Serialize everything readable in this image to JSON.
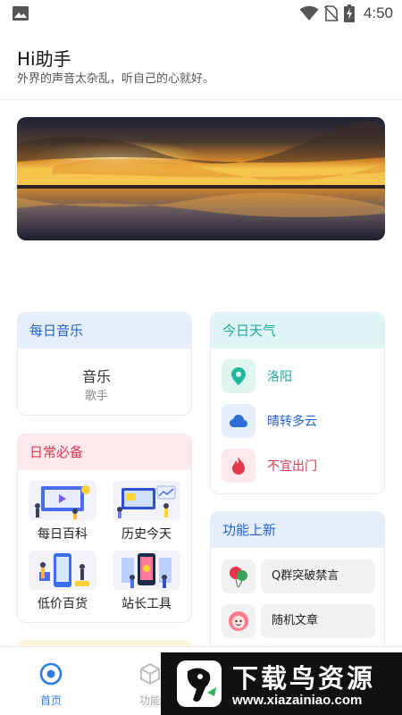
{
  "status_bar": {
    "time": "4:50",
    "icons": [
      "image-icon",
      "wifi-icon",
      "no-sim-icon",
      "battery-charging-icon"
    ]
  },
  "header": {
    "title": "Hi助手",
    "subtitle": "外界的声音太杂乱，听自己的心就好。"
  },
  "banner": {
    "image": "sunset-lake-image"
  },
  "music_card": {
    "title": "每日音乐",
    "song": "音乐",
    "artist": "歌手"
  },
  "weather_card": {
    "title": "今日天气",
    "city": "洛阳",
    "condition": "晴转多云",
    "advice": "不宜出门",
    "colors": {
      "city": "#1ea89a",
      "condition": "#2563c9",
      "advice": "#d63a53"
    }
  },
  "daily_card": {
    "title": "日常必备",
    "tools": [
      {
        "label": "每日百科",
        "icon": "encyclopedia-illustration"
      },
      {
        "label": "历史今天",
        "icon": "history-illustration"
      },
      {
        "label": "低价百货",
        "icon": "shopping-illustration"
      },
      {
        "label": "站长工具",
        "icon": "webmaster-illustration"
      }
    ]
  },
  "new_card": {
    "title": "功能上新",
    "items": [
      {
        "label": "Q群突破禁言",
        "icon": "balloon-icon"
      },
      {
        "label": "随机文章",
        "icon": "flower-face-icon"
      }
    ]
  },
  "bottom_nav": {
    "items": [
      {
        "label": "首页",
        "icon": "home-target-icon",
        "active": true
      },
      {
        "label": "功能",
        "icon": "cube-icon",
        "active": false
      }
    ]
  },
  "watermark": {
    "name": "下载鸟资源",
    "url": "www.xiazainiao.com"
  },
  "colors": {
    "accent": "#2d7ce0",
    "music_header_bg": "#e6eefc",
    "weather_header_bg": "#dff5f5",
    "daily_header_bg": "#fde8ec"
  }
}
